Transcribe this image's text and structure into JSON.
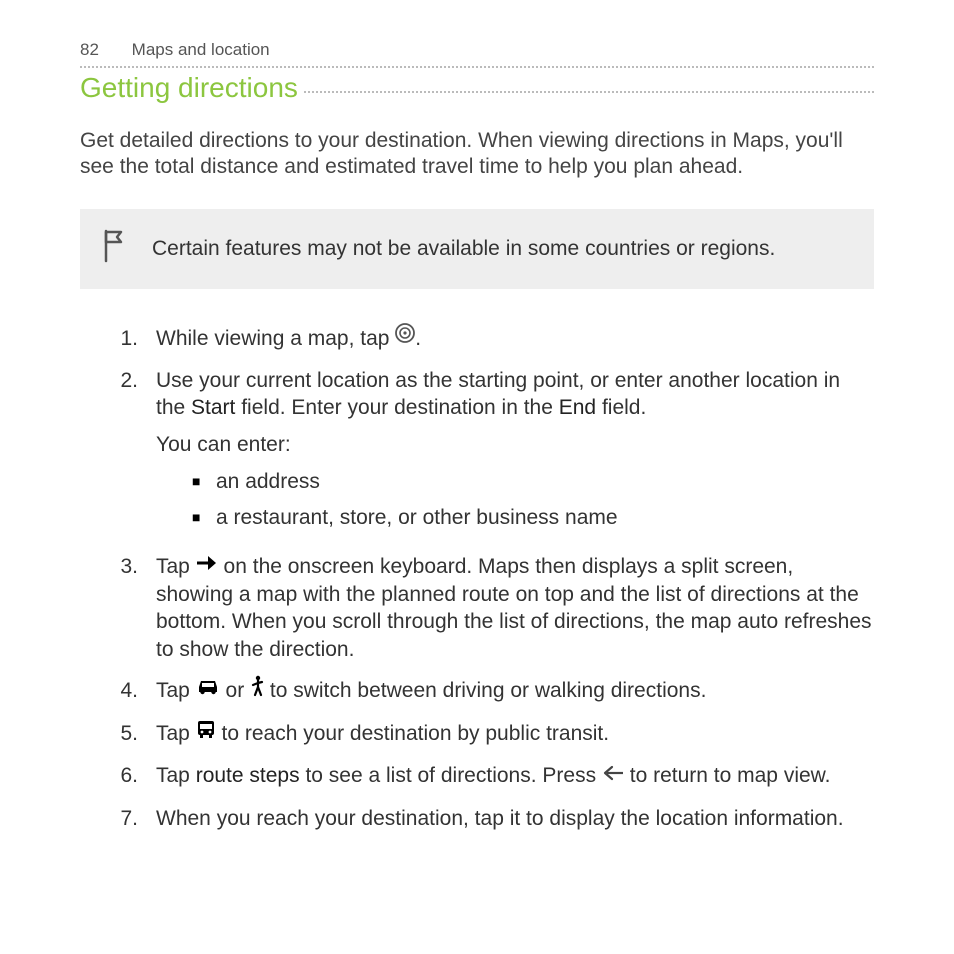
{
  "header": {
    "page_number": "82",
    "chapter": "Maps and location"
  },
  "section_title": "Getting directions",
  "intro": "Get detailed directions to your destination. When viewing directions in Maps, you'll see the total distance and estimated travel time to help you plan ahead.",
  "note": "Certain features may not be available in some countries or regions.",
  "steps": {
    "s1_a": "While viewing a map, tap ",
    "s1_b": ".",
    "s2_a": "Use your current location as the starting point, or enter another location in the ",
    "s2_start": "Start",
    "s2_b": " field. Enter your destination in the ",
    "s2_end": "End",
    "s2_c": " field.",
    "s2_sub": "You can enter:",
    "s2_bullet1": "an address",
    "s2_bullet2": "a restaurant, store, or other business name",
    "s3_a": "Tap ",
    "s3_b": " on the onscreen keyboard. Maps then displays a split screen, showing a map with the planned route on top and the list of directions at the bottom. When you scroll through the list of directions, the map auto refreshes to show the direction.",
    "s4_a": "Tap ",
    "s4_b": " or ",
    "s4_c": " to switch between driving or walking directions.",
    "s5_a": "Tap ",
    "s5_b": " to reach your destination by public transit.",
    "s6_a": "Tap ",
    "s6_route": "route steps",
    "s6_b": " to see a list of directions. Press ",
    "s6_c": " to return to map view.",
    "s7": "When you reach your destination, tap it to display the location information."
  },
  "nums": {
    "n1": "1.",
    "n2": "2.",
    "n3": "3.",
    "n4": "4.",
    "n5": "5.",
    "n6": "6.",
    "n7": "7."
  }
}
